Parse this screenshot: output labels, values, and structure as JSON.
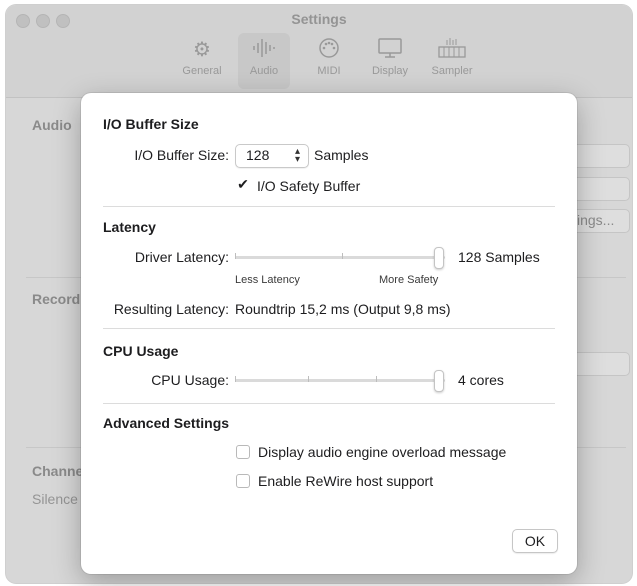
{
  "window": {
    "title": "Settings",
    "toolbar": [
      {
        "label": "General",
        "icon": "gear-icon"
      },
      {
        "label": "Audio",
        "icon": "waveform-icon"
      },
      {
        "label": "MIDI",
        "icon": "midi-port-icon"
      },
      {
        "label": "Display",
        "icon": "display-icon"
      },
      {
        "label": "Sampler",
        "icon": "sampler-icon"
      }
    ],
    "selected_tab": "Audio",
    "background": {
      "audio_label": "Audio",
      "record_label": "Record",
      "channel_label": "Channe",
      "silence_label": "Silence",
      "settings_button": "ings..."
    }
  },
  "sheet": {
    "io_buffer": {
      "section_title": "I/O Buffer Size",
      "buffer_label": "I/O Buffer Size:",
      "buffer_value": "128",
      "buffer_unit": "Samples",
      "safety_buffer_label": "I/O Safety Buffer",
      "safety_buffer_checked": true
    },
    "latency": {
      "section_title": "Latency",
      "driver_label": "Driver Latency:",
      "driver_value": "128 Samples",
      "driver_slider_fraction": 1.0,
      "less_label": "Less Latency",
      "more_label": "More Safety",
      "resulting_label": "Resulting Latency:",
      "resulting_value": "Roundtrip 15,2 ms (Output 9,8 ms)"
    },
    "cpu": {
      "section_title": "CPU Usage",
      "cpu_label": "CPU Usage:",
      "cpu_value": "4 cores",
      "cpu_slider_fraction": 1.0
    },
    "advanced": {
      "section_title": "Advanced Settings",
      "overload_label": "Display audio engine overload message",
      "overload_checked": false,
      "rewire_label": "Enable ReWire host support",
      "rewire_checked": false
    },
    "ok_label": "OK"
  }
}
